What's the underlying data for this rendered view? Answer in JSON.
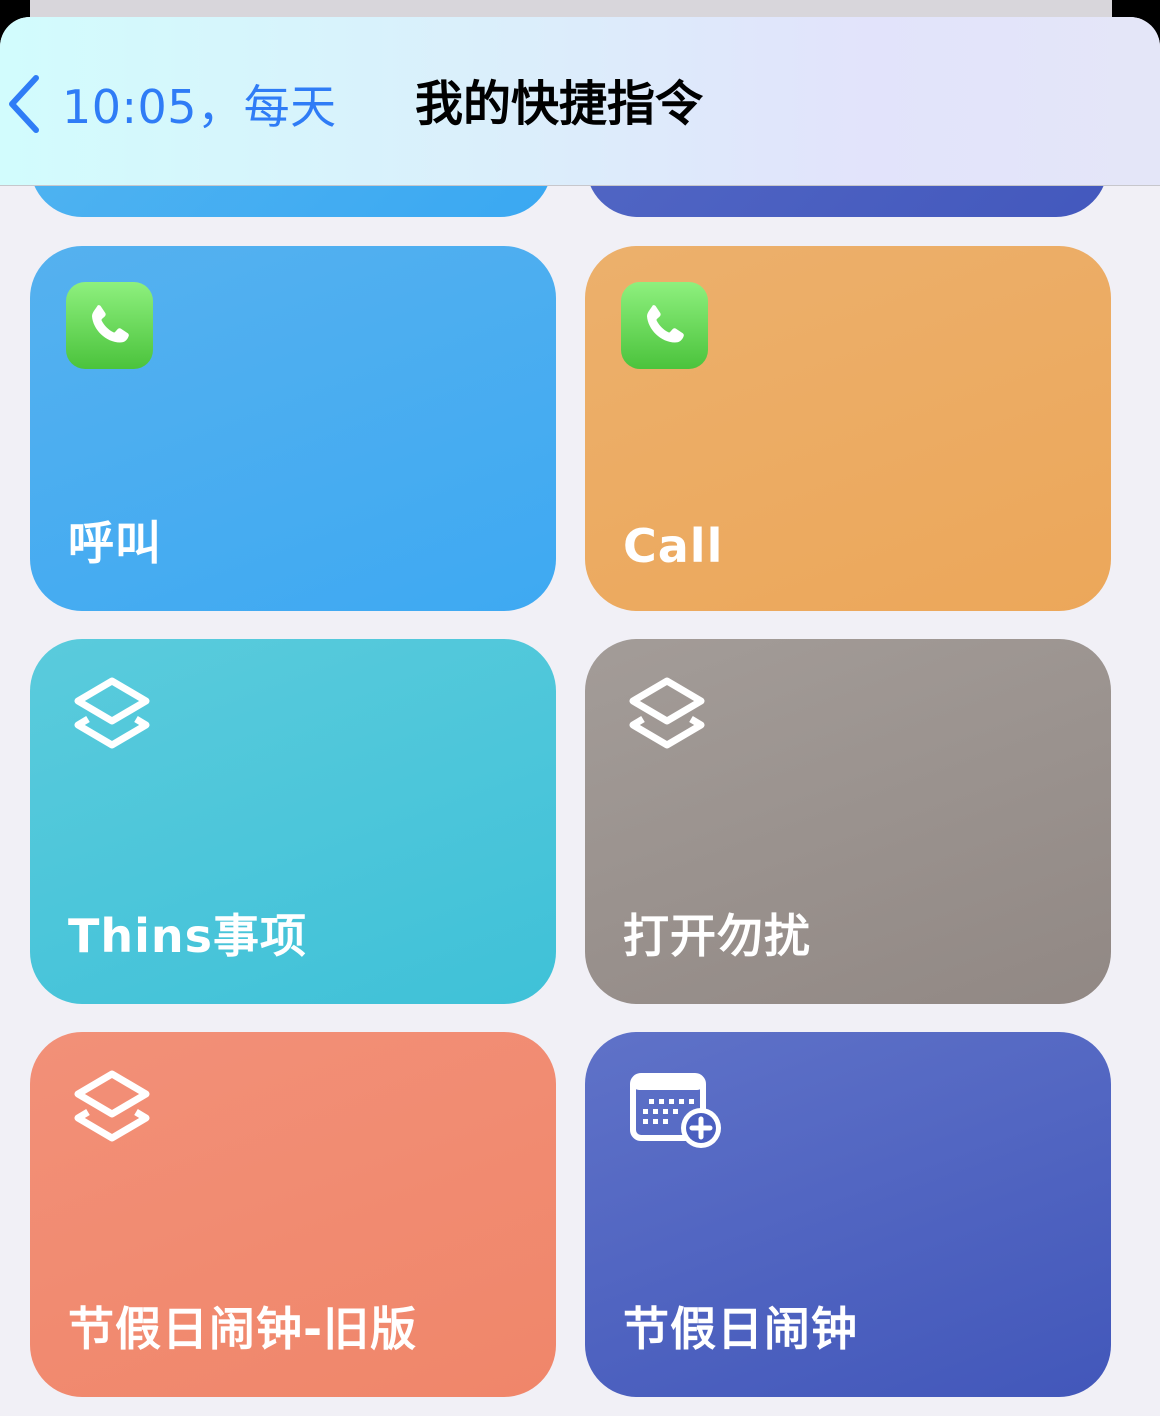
{
  "nav": {
    "back_label": "10:05，每天",
    "title": "我的快捷指令"
  },
  "shortcuts": [
    {
      "label": "呼叫",
      "icon": "phone-app-icon",
      "color": "#4aaef0"
    },
    {
      "label": "Call",
      "icon": "phone-app-icon",
      "color": "#ecaa5e"
    },
    {
      "label": "Thins事项",
      "icon": "layers-icon",
      "color": "#4ac7da"
    },
    {
      "label": "打开勿扰",
      "icon": "layers-icon",
      "color": "#968c88"
    },
    {
      "label": "节假日闹钟-旧版",
      "icon": "layers-icon",
      "color": "#f0876c"
    },
    {
      "label": "节假日闹钟",
      "icon": "calendar-add-icon",
      "color": "#4e63c0"
    }
  ],
  "partial_tiles_colors": [
    "#3faef2",
    "#4b5fc0"
  ]
}
